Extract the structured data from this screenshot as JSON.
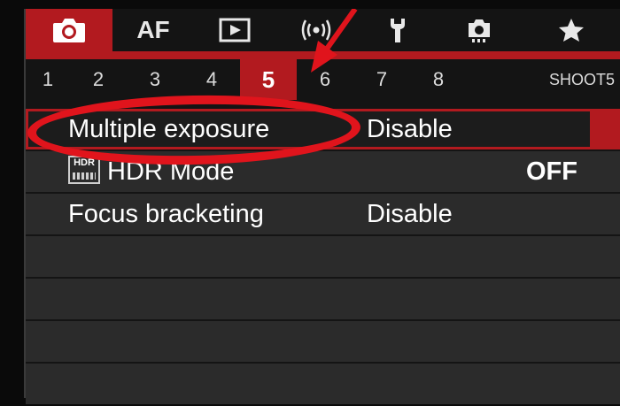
{
  "category_tabs": [
    {
      "icon": "camera-icon",
      "label": "",
      "active": true
    },
    {
      "icon": "af-icon",
      "label": "AF",
      "active": false
    },
    {
      "icon": "playback-icon",
      "label": "",
      "active": false
    },
    {
      "icon": "wireless-icon",
      "label": "",
      "active": false
    },
    {
      "icon": "wrench-icon",
      "label": "",
      "active": false
    },
    {
      "icon": "custom-function-icon",
      "label": "",
      "active": false
    },
    {
      "icon": "star-icon",
      "label": "",
      "active": false
    }
  ],
  "page_numbers": [
    "1",
    "2",
    "3",
    "4",
    "5",
    "6",
    "7",
    "8"
  ],
  "active_page": "5",
  "page_label": "SHOOT5",
  "menu_items": [
    {
      "label": "Multiple exposure",
      "value": "Disable",
      "selected": true
    },
    {
      "label": "HDR Mode",
      "value": "OFF",
      "selected": false,
      "icon": "hdr-icon",
      "icon_text": "HDR"
    },
    {
      "label": "Focus bracketing",
      "value": "Disable",
      "selected": false
    }
  ],
  "colors": {
    "accent": "#b21a1f",
    "annotation": "#e0141c",
    "background": "#141414",
    "row": "#2b2b2b"
  }
}
